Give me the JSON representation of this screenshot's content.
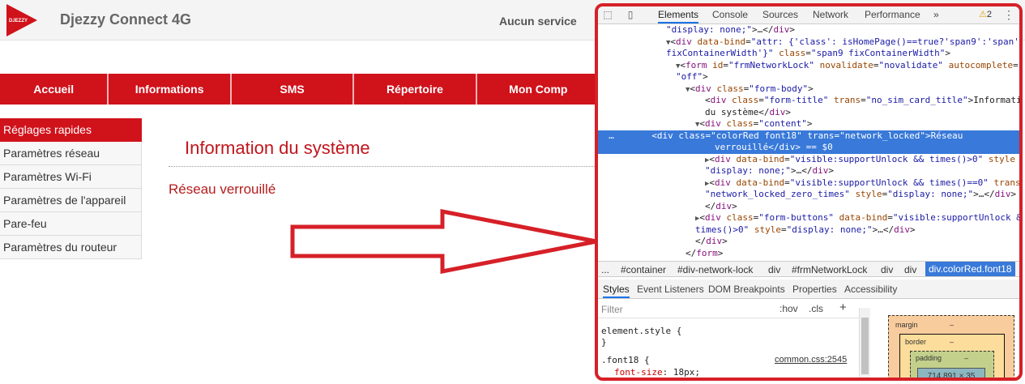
{
  "header": {
    "logo_text": "DJEZZY",
    "brand": "Djezzy Connect 4G",
    "service_status": "Aucun service"
  },
  "nav": {
    "items": [
      "Accueil",
      "Informations",
      "SMS",
      "Répertoire",
      "Mon Comp"
    ]
  },
  "sidebar": {
    "items": [
      "Réglages rapides",
      "Paramètres réseau",
      "Paramètres Wi-Fi",
      "Paramètres de l'appareil",
      "Pare-feu",
      "Paramètres du routeur"
    ],
    "active_index": 0
  },
  "content": {
    "title": "Information du système",
    "status": "Réseau verrouillé"
  },
  "colors": {
    "brand_red": "#d0121b",
    "highlight_border": "#d62028",
    "selection_blue": "#3879d9"
  },
  "devtools": {
    "tabs": [
      "Elements",
      "Console",
      "Sources",
      "Network",
      "Performance"
    ],
    "more_label": "»",
    "active_tab": "Elements",
    "warning_count": "2",
    "breadcrumbs": [
      "...",
      "#container",
      "#div-network-lock",
      "div",
      "#frmNetworkLock",
      "div",
      "div",
      "div.colorRed.font18"
    ],
    "sub_tabs": [
      "Styles",
      "Event Listeners",
      "DOM Breakpoints",
      "Properties",
      "Accessibility"
    ],
    "filter_placeholder": "Filter",
    "hov": ":hov",
    "cls": ".cls",
    "plus": "+",
    "styles": {
      "element_style": "element.style {",
      "close_brace": "}",
      "rule_selector": ".font18 {",
      "rule_property": "font-size",
      "rule_value": "18px;",
      "rule_source": "common.css:2545"
    },
    "box_model": {
      "margin_label": "margin",
      "border_label": "border",
      "padding_label": "padding",
      "dash": "–",
      "content_size": "714.891 × 35"
    }
  }
}
